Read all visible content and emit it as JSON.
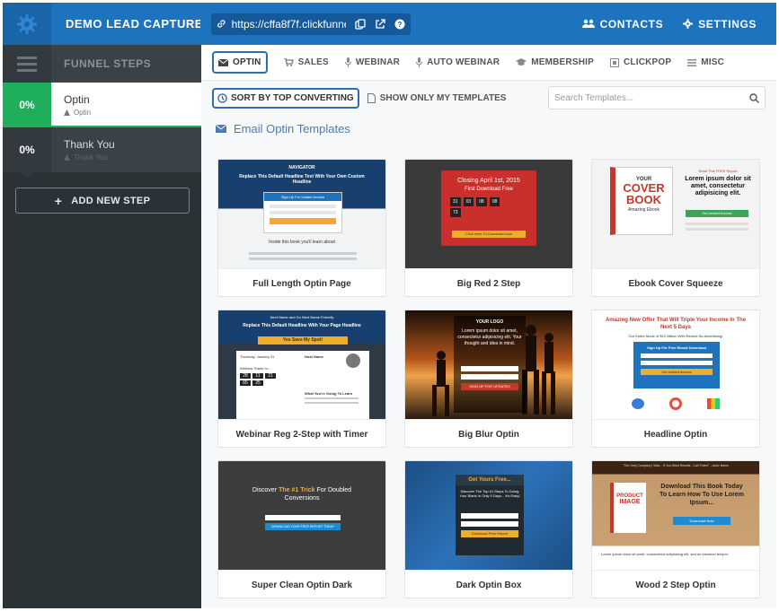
{
  "header": {
    "funnel_title": "DEMO LEAD CAPTURE F...",
    "url": "https://cffa8f7f.clickfunnels",
    "contacts_label": "CONTACTS",
    "settings_label": "SETTINGS",
    "icons": [
      "gear-icon",
      "link-icon",
      "copy-icon",
      "external-link-icon",
      "help-icon",
      "users-icon",
      "settings-gear-icon"
    ]
  },
  "sidebar": {
    "title": "FUNNEL STEPS",
    "steps": [
      {
        "percent": "0%",
        "name": "Optin",
        "type": "Optin",
        "active": true
      },
      {
        "percent": "0%",
        "name": "Thank You",
        "type": "Thank You",
        "active": false
      }
    ],
    "add_step_label": "ADD NEW STEP"
  },
  "tabs": [
    {
      "label": "OPTIN",
      "icon": "envelope-icon",
      "active": true
    },
    {
      "label": "SALES",
      "icon": "cart-icon"
    },
    {
      "label": "WEBINAR",
      "icon": "mic-icon"
    },
    {
      "label": "AUTO WEBINAR",
      "icon": "mic-icon"
    },
    {
      "label": "MEMBERSHIP",
      "icon": "graduation-cap-icon"
    },
    {
      "label": "CLICKPOP",
      "icon": "popup-icon"
    },
    {
      "label": "MISC",
      "icon": "list-icon"
    }
  ],
  "toolbar": {
    "sort_label": "SORT BY TOP CONVERTING",
    "my_templates_label": "SHOW ONLY MY TEMPLATES",
    "search_placeholder": "Search Templates..."
  },
  "section_title": "Email Optin Templates",
  "templates": [
    {
      "name": "Full Length Optin Page",
      "thumb": {
        "logo": "NAVIGATOR",
        "headline": "Replace This Default Headline Text With Your Own Custom Headline",
        "form_title": "Sign Up For Instant Access",
        "subhead": "Inside this book you'll learn about"
      }
    },
    {
      "name": "Big Red 2 Step",
      "thumb": {
        "headline": "Closing April 1st, 2015",
        "subhead": "First Download Free",
        "timer": [
          "31",
          "03",
          "08",
          "08"
        ],
        "timer_extra": "73",
        "button": "Click Here To Download Now"
      }
    },
    {
      "name": "Ebook Cover Squeeze",
      "thumb": {
        "cover_words": [
          "YOUR",
          "COVER",
          "BOOK",
          "Amazing Ebook"
        ],
        "kicker": "Read This FREE Report",
        "headline": "Lorem ipsum dolor sit amet, consectetur adipisicing elit.",
        "button": "Get Instant Access"
      }
    },
    {
      "name": "Webinar Reg 2-Step with Timer",
      "thumb": {
        "kicker": "Next Name and Go Next Name Friendly",
        "headline": "Replace This Default Headline With Your Page Headline",
        "button": "Yes Save My Spot!",
        "date_label": "Thursday, January 31",
        "starts_label": "Webinar Starts In...",
        "timer": [
          "28",
          "11",
          "21",
          "65",
          "25"
        ],
        "host_label": "Host Name",
        "learn_label": "What You're Going To Learn"
      }
    },
    {
      "name": "Big Blur Optin",
      "thumb": {
        "logo": "YOUR LOGO",
        "headline": "Lorem ipsum dolor sit amet, consectetur adipisicing elit. Your thought and idea in mind.",
        "button": "SIGN UP FOR UPDATES"
      }
    },
    {
      "name": "Headline Optin",
      "thumb": {
        "headline": "Amazing New Offer That Will Triple Your Income In The Next 5 Days",
        "subhead": "Our Entire Mode of $10 Million With Recent No Advertising!",
        "form_title": "Sign Up For Free Ebook Download",
        "button": "Get Instant Access"
      }
    },
    {
      "name": "Super Clean Optin Dark",
      "thumb": {
        "headline_pre": "Discover",
        "headline_accent": "The #1 Trick",
        "headline_post": "For Doubled Conversions",
        "button": "DOWNLOAD YOUR FREE REPORT TODAY"
      }
    },
    {
      "name": "Dark Optin Box",
      "thumb": {
        "headline": "Get Yours Free...",
        "subhead": "Discover The Top #1 Steps To Doing Your Blank In Only 5 Days... It's Easy!",
        "button": "Download Free Report"
      }
    },
    {
      "name": "Wood 2 Step Optin",
      "thumb": {
        "top_bar": "\"The Only Company I Was... If You Want Results - Call Them!\" - Actor Name",
        "cover_words": [
          "PRODUCT",
          "IMAGE"
        ],
        "headline": "Download This Book Today To Learn How To Use Lorem Ipsum...",
        "button": "Download Now",
        "footer_text": "Lorem ipsum dolor sit amet, consectetur adipisicing elit, sed do eiusmod tempor."
      }
    }
  ],
  "colors": {
    "brand_blue": "#1e73be",
    "sidebar_dark": "#2b3236",
    "active_green": "#1fae5a",
    "accent_blue": "#2f6db0"
  }
}
